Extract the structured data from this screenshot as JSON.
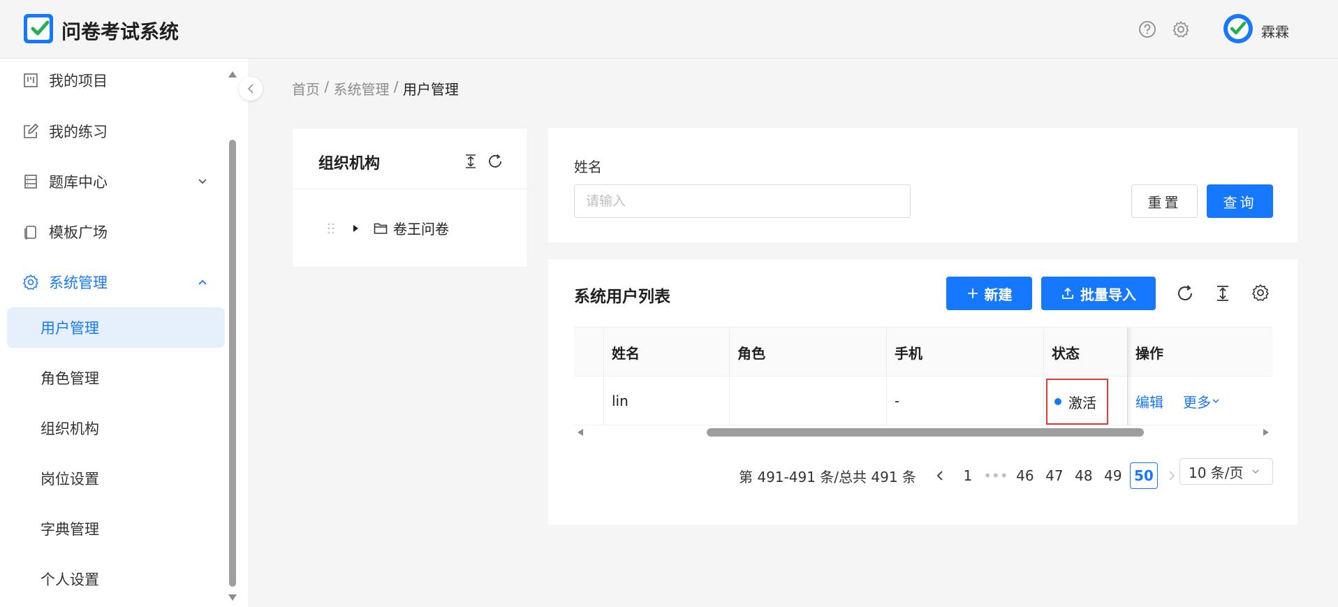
{
  "header": {
    "app_title": "问卷考试系统",
    "username": "霖霖",
    "help_icon": "question-circle-icon",
    "settings_icon": "gear-icon"
  },
  "sidebar": {
    "items": [
      {
        "label": "我的项目",
        "icon": "project-icon"
      },
      {
        "label": "我的练习",
        "icon": "edit-icon"
      },
      {
        "label": "题库中心",
        "icon": "database-icon"
      },
      {
        "label": "模板广场",
        "icon": "copy-icon"
      },
      {
        "label": "系统管理",
        "icon": "gear-icon"
      }
    ],
    "sub_items": [
      {
        "label": "用户管理"
      },
      {
        "label": "角色管理"
      },
      {
        "label": "组织机构"
      },
      {
        "label": "岗位设置"
      },
      {
        "label": "字典管理"
      },
      {
        "label": "个人设置"
      }
    ]
  },
  "breadcrumb": {
    "home": "首页",
    "sep": " / ",
    "section": "系统管理",
    "current": "用户管理"
  },
  "org_panel": {
    "title": "组织机构",
    "tree_node": "卷王问卷"
  },
  "search": {
    "label": "姓名",
    "placeholder": "请输入",
    "reset_label": "重置",
    "query_label": "查询"
  },
  "list": {
    "title": "系统用户列表",
    "new_label": "新建",
    "import_label": "批量导入",
    "columns": [
      "姓名",
      "角色",
      "手机",
      "状态",
      "操作"
    ],
    "rows": [
      {
        "name": "lin",
        "role": "",
        "phone": "-",
        "status": "激活",
        "edit": "编辑",
        "more": "更多"
      }
    ]
  },
  "pagination": {
    "summary": "第 491-491 条/总共 491 条",
    "pages": [
      "1",
      "•••",
      "46",
      "47",
      "48",
      "49",
      "50"
    ],
    "current_page": "50",
    "page_size": "10 条/页"
  },
  "colors": {
    "primary": "#1677ff",
    "highlight": "#e53935"
  }
}
